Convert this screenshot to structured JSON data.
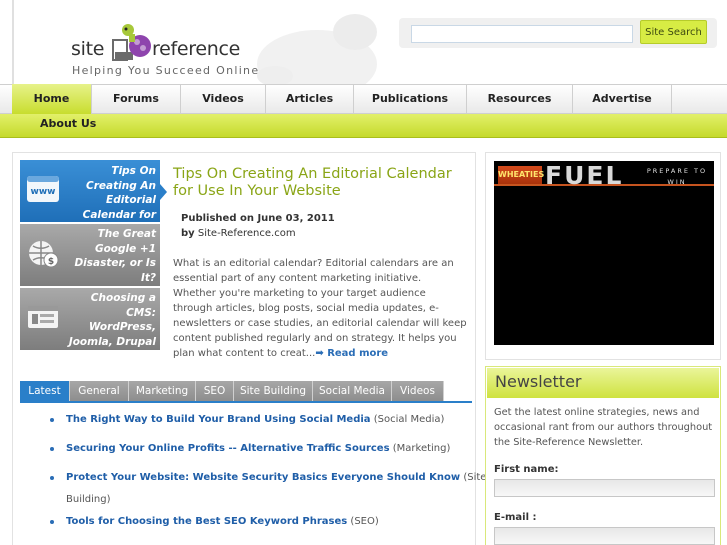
{
  "brand": {
    "name_left": "site",
    "name_right": "reference",
    "tagline": "Helping You Succeed Online",
    "accent": "#c8dd2e",
    "link_color": "#1f5ea8"
  },
  "search": {
    "placeholder": "",
    "button_label": "Site Search"
  },
  "nav": {
    "items": [
      {
        "label": "Home",
        "active": true
      },
      {
        "label": "Forums"
      },
      {
        "label": "Videos"
      },
      {
        "label": "Articles"
      },
      {
        "label": "Publications"
      },
      {
        "label": "Resources"
      },
      {
        "label": "Advertise"
      }
    ],
    "sub_items": [
      {
        "label": "About Us"
      }
    ]
  },
  "featured": {
    "items": [
      {
        "text": "Tips On Creating An Editorial Calendar for Use In Your Website",
        "icon": "www-icon",
        "active": true
      },
      {
        "text": "The Great Google +1 Disaster, or Is It?",
        "icon": "globe-dollar-icon"
      },
      {
        "text": "Choosing a CMS: WordPress, Joomla, Drupal & Expression",
        "icon": "cms-icon"
      }
    ],
    "article": {
      "title": "Tips On Creating An Editorial Calendar for Use In Your Website",
      "published_prefix": "Published on ",
      "published_date": "June 03, 2011",
      "by_prefix": "by",
      "author": "Site-Reference.com",
      "body": "What is an editorial calendar? Editorial calendars are an essential part of any content marketing initiative.  Whether you're marketing to your target audience through articles, blog posts, social media updates, e-newsletters or case studies, an editorial calendar will keep content published regularly and on strategy.  It helps you plan what content to creat...",
      "read_more": "Read more"
    }
  },
  "tabs": {
    "items": [
      {
        "label": "Latest",
        "active": true
      },
      {
        "label": "General"
      },
      {
        "label": "Marketing"
      },
      {
        "label": "SEO"
      },
      {
        "label": "Site Building"
      },
      {
        "label": "Social Media"
      },
      {
        "label": "Videos"
      }
    ],
    "articles": [
      {
        "title": "The Right Way to Build Your Brand Using Social Media",
        "category": "(Social Media)"
      },
      {
        "title": "Securing Your Online Profits -- Alternative Traffic Sources",
        "category": "(Marketing)"
      },
      {
        "title": "Protect Your Website: Website Security Basics Everyone Should Know",
        "category_a": "(Site",
        "category_b": "Building)"
      },
      {
        "title": "Tools for Choosing the Best SEO Keyword Phrases",
        "category": "(SEO)"
      }
    ]
  },
  "ad": {
    "brand": "WHEATIES",
    "headline": "FUEL",
    "tag_line_1": "PREPARE TO",
    "tag_line_2": "WIN"
  },
  "newsletter": {
    "title": "Newsletter",
    "description": "Get the latest online strategies, news and occasional rant from our authors throughout the Site-Reference Newsletter.",
    "first_name_label": "First name:",
    "email_label": "E-mail :"
  }
}
